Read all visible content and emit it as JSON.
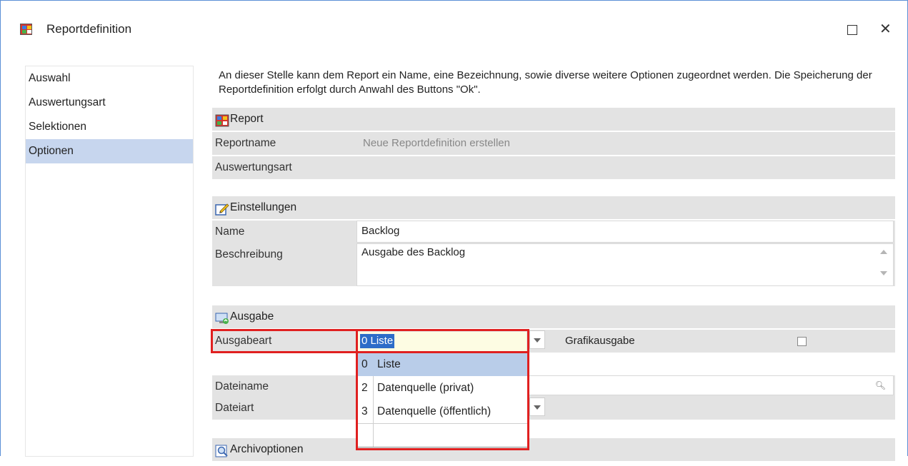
{
  "window": {
    "title": "Reportdefinition"
  },
  "nav": {
    "items": [
      {
        "label": "Auswahl"
      },
      {
        "label": "Auswertungsart"
      },
      {
        "label": "Selektionen"
      },
      {
        "label": "Optionen"
      }
    ]
  },
  "intro_text": "An dieser Stelle kann dem Report ein Name, eine Bezeichnung, sowie diverse weitere Optionen zugeordnet werden. Die Speicherung der Reportdefinition erfolgt durch Anwahl des Buttons \"Ok\".",
  "report": {
    "header": "Report",
    "reportname_label": "Reportname",
    "reportname_value": "Neue Reportdefinition erstellen",
    "auswertungsart_label": "Auswertungsart",
    "auswertungsart_value": ""
  },
  "einstellungen": {
    "header": "Einstellungen",
    "name_label": "Name",
    "name_value": "Backlog",
    "beschreibung_label": "Beschreibung",
    "beschreibung_value": "Ausgabe des Backlog"
  },
  "ausgabe": {
    "header": "Ausgabe",
    "ausgabeart_label": "Ausgabeart",
    "ausgabeart_value": "0 Liste",
    "grafikausgabe_label": "Grafikausgabe",
    "grafikausgabe_checked": false,
    "dateiname_label": "Dateiname",
    "dateiart_label": "Dateiart",
    "dropdown_options": [
      {
        "key": "0",
        "text": "Liste",
        "selected": true
      },
      {
        "key": "2",
        "text": "Datenquelle (privat)"
      },
      {
        "key": "3",
        "text": "Datenquelle (öffentlich)"
      },
      {
        "key": "",
        "text": ""
      }
    ]
  },
  "archivoptionen": {
    "header": "Archivoptionen"
  },
  "colors": {
    "selection": "#2d6cc8",
    "highlight_border": "#e02020",
    "section_bg": "#e3e3e3",
    "nav_selected": "#c7d6ee"
  }
}
